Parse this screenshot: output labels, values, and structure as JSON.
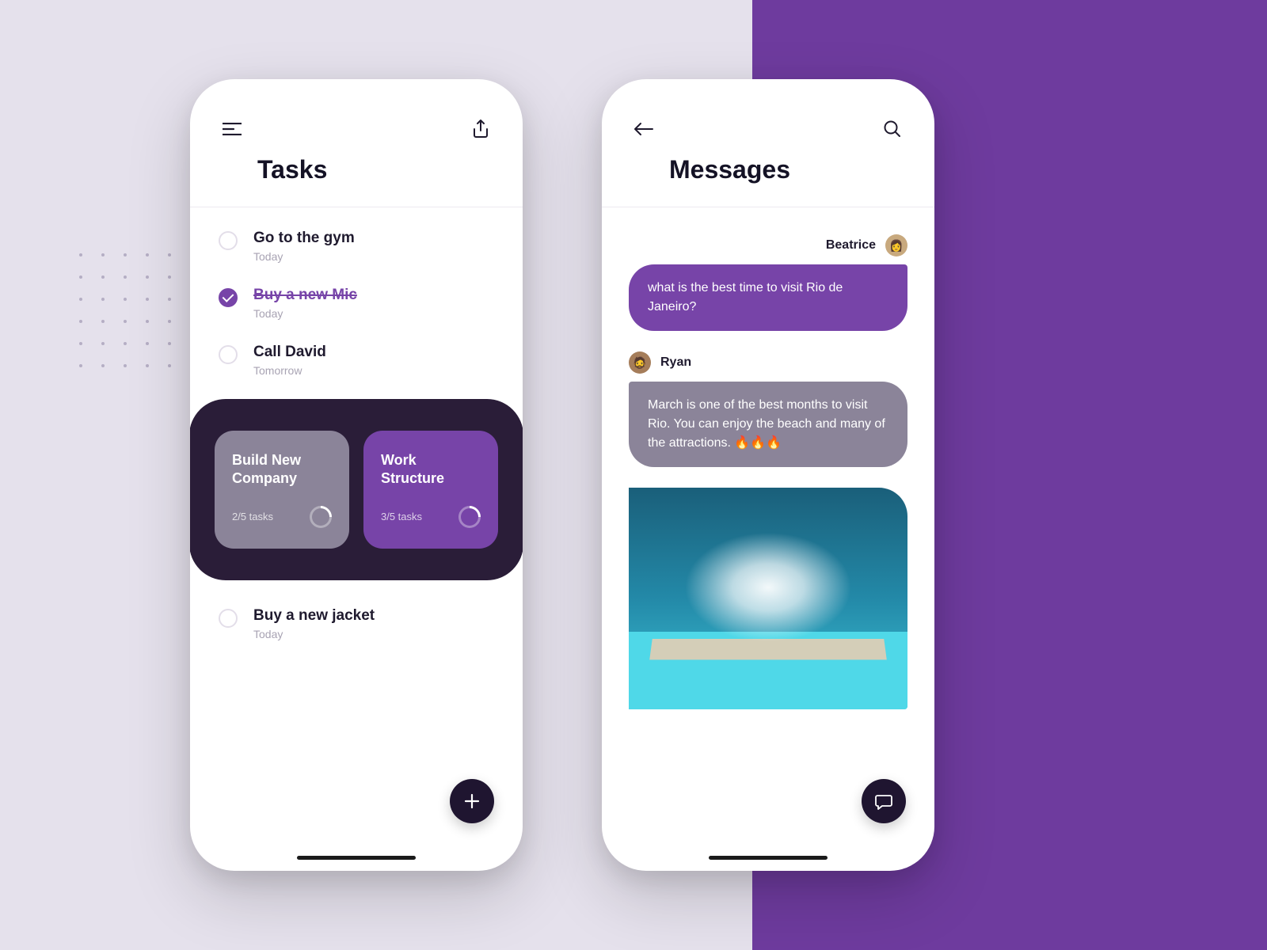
{
  "tasks_screen": {
    "title": "Tasks",
    "items": [
      {
        "label": "Go to the gym",
        "sub": "Today",
        "done": false
      },
      {
        "label": "Buy a new Mic",
        "sub": "Today",
        "done": true
      },
      {
        "label": "Call David",
        "sub": "Tomorrow",
        "done": false
      }
    ],
    "projects": [
      {
        "label": "Build New Company",
        "count": "2/5 tasks"
      },
      {
        "label": "Work Structure",
        "count": "3/5 tasks"
      }
    ],
    "bottom_task": {
      "label": "Buy a new jacket",
      "sub": "Today"
    }
  },
  "messages_screen": {
    "title": "Messages",
    "sender1": "Beatrice",
    "bubble1": "what is the best time to visit Rio de Janeiro?",
    "sender2": "Ryan",
    "bubble2": "March is one of the best months to visit Rio. You can enjoy the beach and many of the attractions. 🔥🔥🔥"
  }
}
